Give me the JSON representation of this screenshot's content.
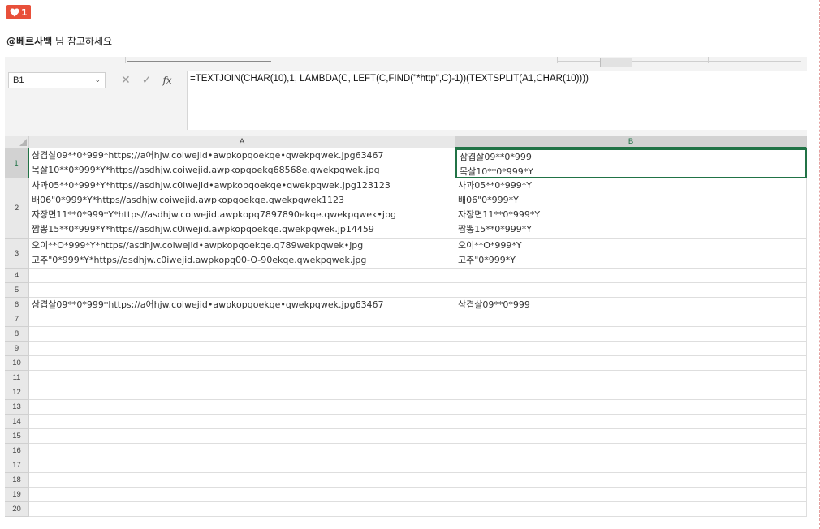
{
  "like": {
    "count": "1"
  },
  "mention": {
    "user": "@베르사백",
    "text": " 님 참고하세요"
  },
  "namebox": {
    "value": "B1"
  },
  "formula_bar": {
    "fx_label": "fx",
    "formula": "=TEXTJOIN(CHAR(10),1, LAMBDA(C, LEFT(C,FIND(\"*http\",C)-1))(TEXTSPLIT(A1,CHAR(10))))"
  },
  "columns": [
    {
      "label": "A",
      "selected": false
    },
    {
      "label": "B",
      "selected": true
    }
  ],
  "rows": [
    {
      "num": "1",
      "a": "삼겹살09**0*999*https;//a어hjw.coiwejid•awpkopqoekqe•qwekpqwek.jpg63467\n목살10**0*999*Y*https//asdhjw.coiwejid.awpkopqoekq68568e.qwekpqwek.jpg",
      "b": "삼겹살09**0*999\n목살10**0*999*Y"
    },
    {
      "num": "2",
      "a": "사과05**0*999*Y*https//asdhjw.c0iwejid•awpkopqoekqe•qwekpqwek.jpg123123\n배06\"0*999*Y*https//asdhjw.coiwejid.awpkopqoekqe.qwekpqwek1123\n자장면11**0*999*Y*https//asdhjw.coiwejid.awpkopq7897890ekqe.qwekpqwek•jpg\n짬뽕15**0*999*Y*https//asdhjw.c0iwejid.awpkopqoekqe.qwekpqwek.jp14459",
      "b": "사과05**0*999*Y\n배06\"0*999*Y\n자장면11**0*999*Y\n짬뽕15**0*999*Y"
    },
    {
      "num": "3",
      "a": "오이**O*999*Y*https//asdhjw.coiwejid•awpkopqoekqe.q789wekpqwek•jpg\n고추\"0*999*Y*https//asdhjw.c0iwejid.awpkopq00-O-90ekqe.qwekpqwek.jpg",
      "b": "오이**O*999*Y\n고추\"0*999*Y"
    },
    {
      "num": "4",
      "a": "",
      "b": ""
    },
    {
      "num": "5",
      "a": "",
      "b": ""
    },
    {
      "num": "6",
      "a": "삼겹살09**0*999*https;//a어hjw.coiwejid•awpkopqoekqe•qwekpqwek.jpg63467",
      "b": "삼겹살09**0*999"
    },
    {
      "num": "7",
      "a": "",
      "b": ""
    },
    {
      "num": "8",
      "a": "",
      "b": ""
    },
    {
      "num": "9",
      "a": "",
      "b": ""
    },
    {
      "num": "10",
      "a": "",
      "b": ""
    },
    {
      "num": "11",
      "a": "",
      "b": ""
    },
    {
      "num": "12",
      "a": "",
      "b": ""
    },
    {
      "num": "13",
      "a": "",
      "b": ""
    },
    {
      "num": "14",
      "a": "",
      "b": ""
    },
    {
      "num": "15",
      "a": "",
      "b": ""
    },
    {
      "num": "16",
      "a": "",
      "b": ""
    },
    {
      "num": "17",
      "a": "",
      "b": ""
    },
    {
      "num": "18",
      "a": "",
      "b": ""
    },
    {
      "num": "19",
      "a": "",
      "b": ""
    },
    {
      "num": "20",
      "a": "",
      "b": ""
    }
  ]
}
